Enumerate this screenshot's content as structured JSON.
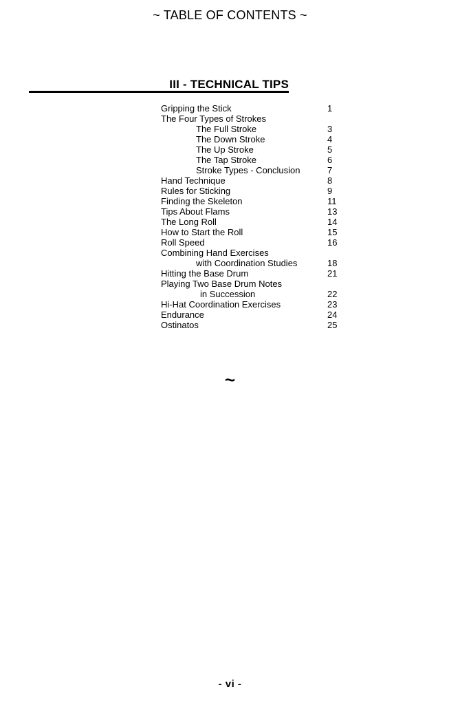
{
  "document": {
    "title": "~ TABLE OF CONTENTS ~",
    "ornament": "~",
    "footer": "- vi -",
    "background_color": "#ffffff",
    "text_color": "#000000"
  },
  "section": {
    "heading": "III - TECHNICAL TIPS"
  },
  "toc": {
    "entries": [
      {
        "label": "Gripping the Stick",
        "page": "1",
        "level": 1
      },
      {
        "label": "The Four Types of Strokes",
        "page": "",
        "level": 1
      },
      {
        "label": "The Full Stroke",
        "page": "3",
        "level": 2
      },
      {
        "label": "The Down Stroke",
        "page": "4",
        "level": 2
      },
      {
        "label": "The Up Stroke",
        "page": "5",
        "level": 2
      },
      {
        "label": "The Tap Stroke",
        "page": "6",
        "level": 2
      },
      {
        "label": "Stroke Types - Conclusion",
        "page": "7",
        "level": 2
      },
      {
        "label": "Hand Technique",
        "page": "8",
        "level": 1
      },
      {
        "label": "Rules for Sticking",
        "page": "9",
        "level": 1
      },
      {
        "label": "Finding the Skeleton",
        "page": "11",
        "level": 1
      },
      {
        "label": "Tips About Flams",
        "page": "13",
        "level": 1
      },
      {
        "label": "The Long Roll",
        "page": "14",
        "level": 1
      },
      {
        "label": "How to Start the Roll",
        "page": "15",
        "level": 1
      },
      {
        "label": "Roll Speed",
        "page": "16",
        "level": 1
      },
      {
        "label": "Combining Hand Exercises",
        "page": "",
        "level": 1
      },
      {
        "label": "with Coordination Studies",
        "page": "18",
        "level": 2
      },
      {
        "label": "Hitting the Base Drum",
        "page": "21",
        "level": 1
      },
      {
        "label": "Playing Two Base Drum Notes",
        "page": "",
        "level": 1
      },
      {
        "label": "in Succession",
        "page": "22",
        "level": 3
      },
      {
        "label": "Hi-Hat Coordination Exercises",
        "page": "23",
        "level": 1
      },
      {
        "label": "Endurance",
        "page": "24",
        "level": 1
      },
      {
        "label": "Ostinatos",
        "page": "25",
        "level": 1
      }
    ]
  }
}
